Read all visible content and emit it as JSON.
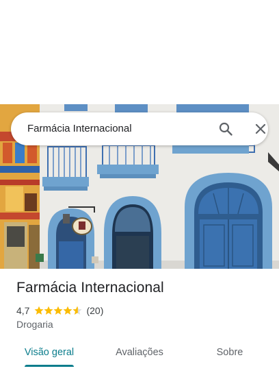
{
  "search": {
    "query": "Farmácia Internacional"
  },
  "icons": {
    "search": "search-icon",
    "close": "close-icon",
    "star_full": "star-icon",
    "star_half": "star-half-icon"
  },
  "place": {
    "name": "Farmácia Internacional",
    "rating": "4,7",
    "rating_stars": 4.7,
    "reviews": "(20)",
    "category": "Drogaria"
  },
  "tabs": [
    {
      "label": "Visão geral",
      "selected": true
    },
    {
      "label": "Avaliações",
      "selected": false
    },
    {
      "label": "Sobre",
      "selected": false
    }
  ],
  "colors": {
    "accent": "#0b7d8c",
    "star": "#fbbc04",
    "facade": "#eceae6",
    "trim": "#6fa3cf",
    "door": "#3b72b0"
  }
}
